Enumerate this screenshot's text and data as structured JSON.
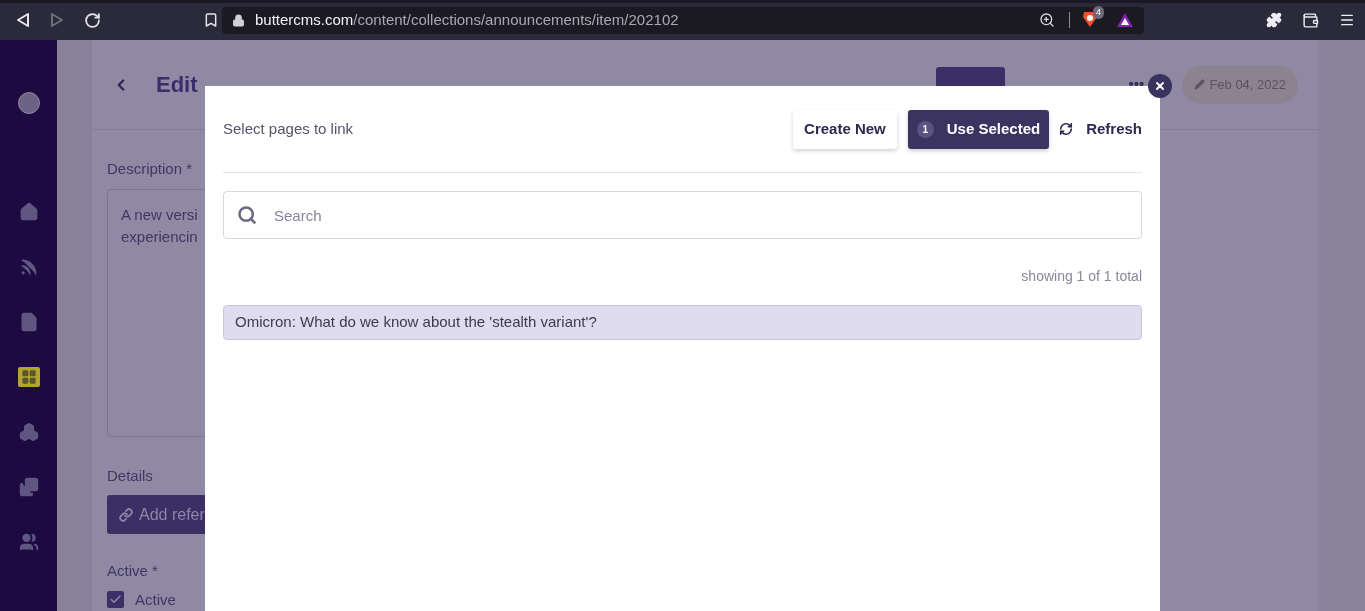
{
  "browser": {
    "url_host": "buttercms.com",
    "url_path": "/content/collections/announcements/item/202102",
    "forward_disabled": true,
    "shields_badge": "4"
  },
  "sidebar": {
    "items": [
      {
        "selected": false
      },
      {
        "selected": false
      },
      {
        "selected": false
      },
      {
        "selected": true
      },
      {
        "selected": false
      },
      {
        "selected": false
      },
      {
        "selected": false
      }
    ]
  },
  "page": {
    "title": "Edit",
    "more": "•••",
    "date": "Feb 04, 2022",
    "description": {
      "label": "Description *",
      "lines": [
        "A new versi",
        "experiencin"
      ]
    },
    "details": {
      "label": "Details",
      "button": "Add refer"
    },
    "active": {
      "label": "Active *",
      "checkbox": {
        "label": "Active",
        "checked": true
      }
    }
  },
  "modal": {
    "title": "Select pages to link",
    "create_button": "Create New",
    "use_selected": {
      "count": "1",
      "label": "Use Selected"
    },
    "refresh": "Refresh",
    "search": {
      "placeholder": "Search"
    },
    "count_text": "showing 1 of 1 total",
    "results": [
      {
        "title": "Omicron: What do we know about the 'stealth variant'?",
        "selected": true
      }
    ]
  }
}
